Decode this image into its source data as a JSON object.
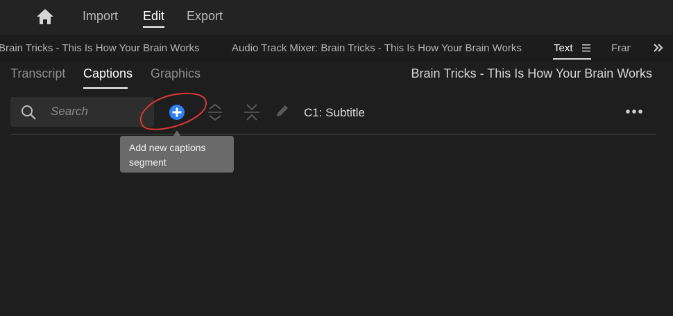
{
  "workspace": {
    "icon": "home-icon",
    "items": [
      "Import",
      "Edit",
      "Export"
    ],
    "active": "Edit"
  },
  "panel_tabs": {
    "items": [
      "Brain Tricks - This Is How Your Brain Works",
      "Audio Track Mixer: Brain Tricks - This Is How Your Brain Works",
      "Text",
      "Fran"
    ],
    "active": "Text",
    "overflow_icon": "double-chevron-right-icon",
    "menu_icon": "hamburger-menu-icon"
  },
  "sub_tabs": {
    "items": [
      "Transcript",
      "Captions",
      "Graphics"
    ],
    "active": "Captions",
    "sequence_title": "Brain Tricks - This Is How Your Brain Works"
  },
  "toolbar": {
    "search_placeholder": "Search",
    "search_icon": "search-icon",
    "add_icon": "add-circle-icon",
    "split_icon": "split-segment-icon",
    "merge_icon": "merge-segments-icon",
    "edit_icon": "pencil-icon",
    "track_label": "C1: Subtitle",
    "more_icon": "more-horizontal-icon"
  },
  "tooltip": {
    "line1": "Add new captions",
    "line2": "segment"
  },
  "colors": {
    "background": "#1e1e1e",
    "accent_blue": "#2f7ff0",
    "annotation_red": "#d8383a",
    "tooltip_bg": "#6a6a6a"
  }
}
